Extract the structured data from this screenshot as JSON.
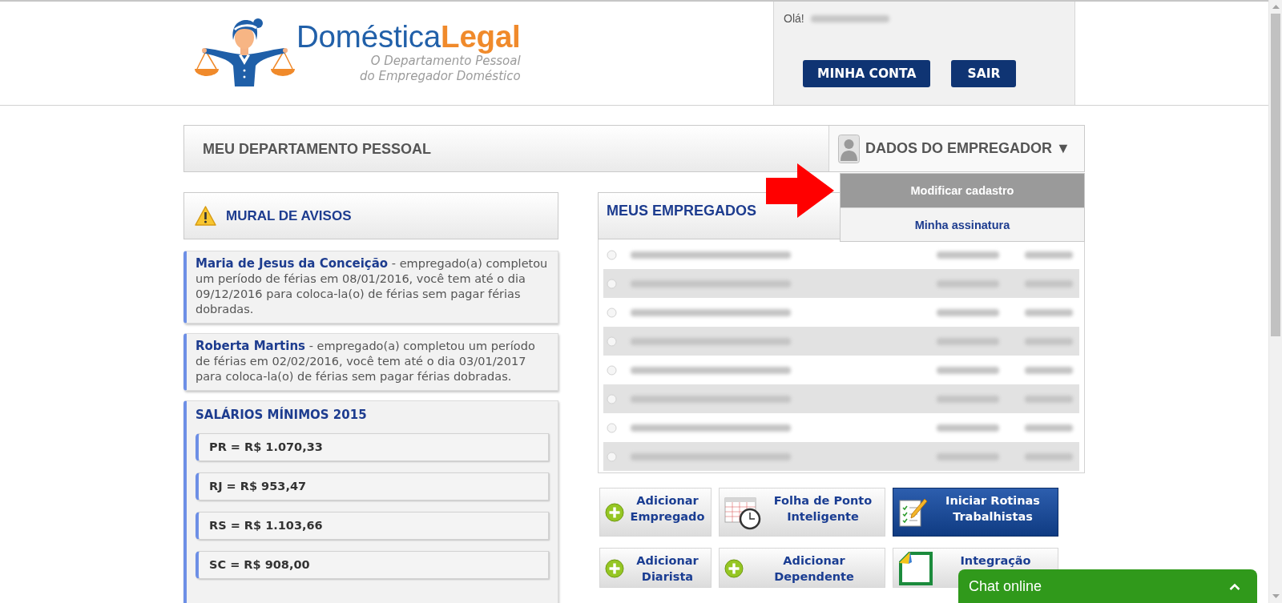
{
  "header": {
    "logo": {
      "wordmark": "Doméstica**Legal**",
      "tagline": [
        "O Departamento Pessoal",
        "do Empregador Doméstico"
      ]
    },
    "account": {
      "greeting": "Olá!",
      "buttons": [
        "MINHA CONTA",
        "SAIR"
      ]
    }
  },
  "top_bar": {
    "title": "MEU DEPARTAMENTO PESSOAL",
    "menu": {
      "label": "DADOS DO EMPREGADOR",
      "caret": "▼",
      "expanded": true,
      "items": [
        {
          "label": "Modificar cadastro",
          "selected": true
        },
        {
          "label": "Minha assinatura",
          "selected": false
        }
      ]
    }
  },
  "notices": {
    "title": "MURAL DE AVISOS",
    "items": [
      "**Maria de Jesus da Conceição** - empregado(a) completou um período de férias em 08/01/2016, você tem até o dia 09/12/2016 para coloca-la(o) de férias sem pagar férias dobradas.",
      "**Roberta Martins** - empregado(a) completou um período de férias em 02/02/2016, você tem até o dia 03/01/2017 para coloca-la(o) de férias sem pagar férias dobradas."
    ]
  },
  "minimum_wages": {
    "title": "SALÁRIOS MÍNIMOS 2015",
    "items": [
      "PR = R$ 1.070,33",
      "RJ = R$ 953,47",
      "RS = R$ 1.103,66",
      "SC = R$ 908,00"
    ]
  },
  "employees": {
    "title": "MEUS EMPREGADOS",
    "rows": [
      {
        "shaded": false
      },
      {
        "shaded": true
      },
      {
        "shaded": false
      },
      {
        "shaded": true
      },
      {
        "shaded": false
      },
      {
        "shaded": true
      },
      {
        "shaded": false
      },
      {
        "shaded": true
      }
    ]
  },
  "actions": [
    {
      "kind": "add",
      "label": [
        "Adicionar",
        "Empregado"
      ],
      "primary": false
    },
    {
      "kind": "timesheet",
      "label": [
        "Folha de Ponto",
        "Inteligente"
      ],
      "primary": false
    },
    {
      "kind": "routines",
      "label": [
        "Iniciar Rotinas",
        "Trabalhistas"
      ],
      "primary": true
    },
    {
      "kind": "add",
      "label": [
        "Adicionar",
        "Diarista"
      ],
      "primary": false
    },
    {
      "kind": "add",
      "label": [
        "Adicionar",
        "Dependente"
      ],
      "primary": false
    },
    {
      "kind": "document",
      "label": [
        "Integração"
      ],
      "primary": false
    }
  ],
  "chat": {
    "label": "Chat online",
    "expanded": false
  }
}
